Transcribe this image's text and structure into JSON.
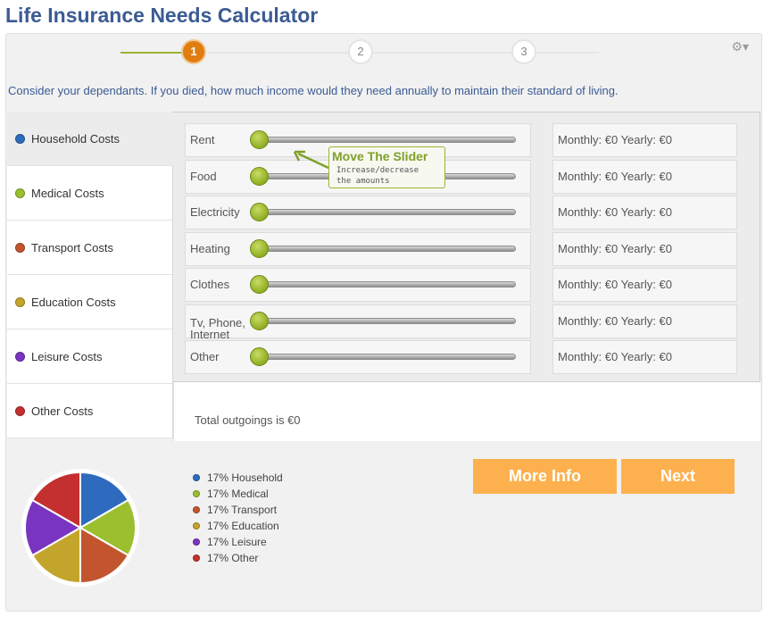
{
  "page": {
    "title": "Life Insurance Needs Calculator"
  },
  "steps": [
    {
      "label": "1",
      "active": true
    },
    {
      "label": "2",
      "active": false
    },
    {
      "label": "3",
      "active": false
    }
  ],
  "instructions": "Consider your dependants. If you died, how much income would they need annually to maintain their standard of living.",
  "categories": [
    {
      "label": "Household Costs",
      "color": "#2e6bbf",
      "active": true
    },
    {
      "label": "Medical Costs",
      "color": "#9bbf2e",
      "active": false
    },
    {
      "label": "Transport Costs",
      "color": "#c2552e",
      "active": false
    },
    {
      "label": "Education Costs",
      "color": "#c4a52b",
      "active": false
    },
    {
      "label": "Leisure Costs",
      "color": "#7a35c0",
      "active": false
    },
    {
      "label": "Other Costs",
      "color": "#c42f2f",
      "active": false
    }
  ],
  "rows": [
    {
      "label": "Rent",
      "value": "Monthly: €0 Yearly: €0"
    },
    {
      "label": "Food",
      "value": "Monthly: €0 Yearly: €0"
    },
    {
      "label": "Electricity",
      "value": "Monthly: €0 Yearly: €0"
    },
    {
      "label": "Heating",
      "value": "Monthly: €0 Yearly: €0"
    },
    {
      "label": "Clothes",
      "value": "Monthly: €0 Yearly: €0"
    },
    {
      "label": "Tv, Phone, Internet",
      "value": "Monthly: €0 Yearly: €0"
    },
    {
      "label": "Other",
      "value": "Monthly: €0 Yearly: €0"
    }
  ],
  "tooltip": {
    "title": "Move The Slider",
    "line1": "Increase/decrease",
    "line2": "the amounts"
  },
  "total": "Total outgoings is €0",
  "buttons": {
    "more_info": "More Info",
    "next": "Next"
  },
  "legend": [
    {
      "label": "17% Household",
      "color": "#2e6bbf"
    },
    {
      "label": "17% Medical",
      "color": "#9bbf2e"
    },
    {
      "label": "17% Transport",
      "color": "#c2552e"
    },
    {
      "label": "17% Education",
      "color": "#c4a52b"
    },
    {
      "label": "17% Leisure",
      "color": "#7a35c0"
    },
    {
      "label": "17% Other",
      "color": "#c42f2f"
    }
  ],
  "pie": {
    "values": [
      17,
      17,
      17,
      17,
      17,
      17
    ]
  },
  "icons": {
    "settings": "gear-icon"
  }
}
